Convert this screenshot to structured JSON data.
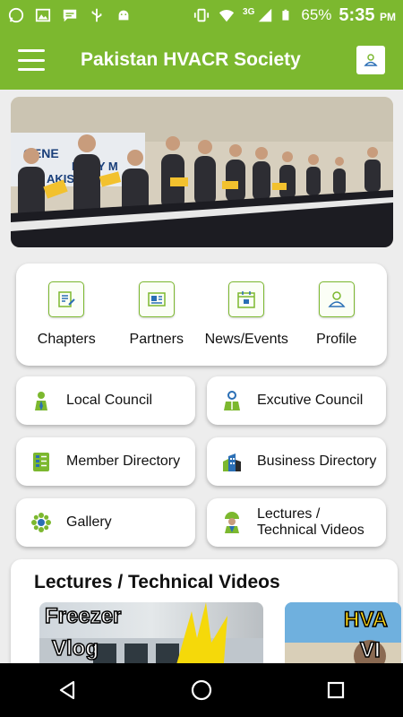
{
  "status_bar": {
    "battery": "65%",
    "network": "3G",
    "time": "5:35",
    "ampm": "PM"
  },
  "app_bar": {
    "title": "Pakistan HVACR Society",
    "menu_icon": "hamburger-menu-icon",
    "action_icon": "profile-icon"
  },
  "banner": {
    "image": "general-body-meeting-oath-photo",
    "visible_text": "GENERAL BODY MEETING PAKISTAN HVACR"
  },
  "quick_links": [
    {
      "label": "Chapters",
      "icon": "chapters-icon"
    },
    {
      "label": "Partners",
      "icon": "partners-icon"
    },
    {
      "label": "News/Events",
      "icon": "news-events-icon"
    },
    {
      "label": "Profile",
      "icon": "profile-icon"
    }
  ],
  "menu_buttons": [
    {
      "label": "Local Council",
      "icon": "local-council-icon"
    },
    {
      "label": "Excutive Council",
      "icon": "executive-council-icon"
    },
    {
      "label": "Member Directory",
      "icon": "member-directory-icon"
    },
    {
      "label": "Business Directory",
      "icon": "business-directory-icon"
    },
    {
      "label": "Gallery",
      "icon": "gallery-icon"
    },
    {
      "label_line1": "Lectures /",
      "label_line2": "Technical Videos",
      "icon": "lectures-icon"
    }
  ],
  "lectures_section": {
    "title": "Lectures / Technical Videos",
    "videos": [
      {
        "line1": "Freezer",
        "line2": "Vlog"
      },
      {
        "line1": "HVA",
        "line2": "VI"
      }
    ]
  },
  "colors": {
    "brand_green": "#7cb82f",
    "background": "#ededed"
  }
}
